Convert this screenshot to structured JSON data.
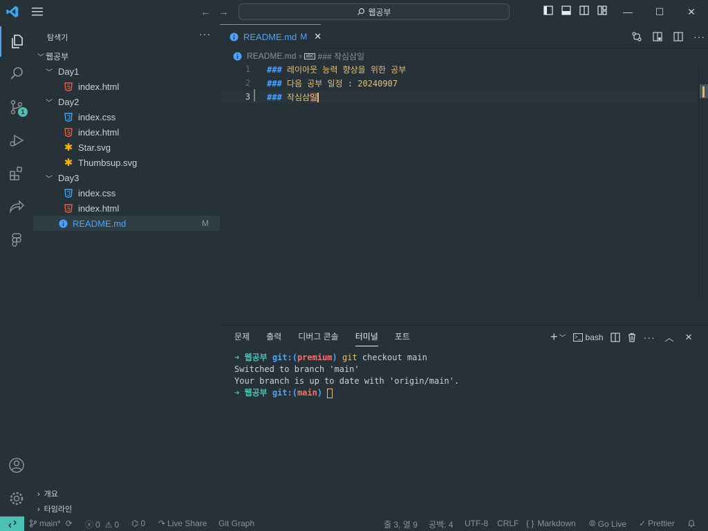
{
  "title_bar": {
    "search_text": "웹공부",
    "back": "←",
    "forward": "→"
  },
  "activity_bar": {
    "scm_badge": "1"
  },
  "sidebar": {
    "title": "탐색기",
    "more": "···",
    "root": "웹공부",
    "items": [
      {
        "type": "folder",
        "label": "Day1"
      },
      {
        "type": "html",
        "label": "index.html"
      },
      {
        "type": "folder",
        "label": "Day2"
      },
      {
        "type": "css",
        "label": "index.css"
      },
      {
        "type": "html",
        "label": "index.html"
      },
      {
        "type": "svg",
        "label": "Star.svg"
      },
      {
        "type": "svg",
        "label": "Thumbsup.svg"
      },
      {
        "type": "folder",
        "label": "Day3"
      },
      {
        "type": "css",
        "label": "index.css"
      },
      {
        "type": "html",
        "label": "index.html"
      },
      {
        "type": "md",
        "label": "README.md",
        "status": "M"
      }
    ],
    "outline": "개요",
    "timeline": "타임라인"
  },
  "editor": {
    "tab_label": "README.md",
    "tab_status": "M",
    "breadcrumb_file": "README.md",
    "breadcrumb_symbol": "### 작심삼일",
    "lines": [
      {
        "num": "1",
        "hash": "###",
        "text": " 레이아웃 능력 향상을 위한 공부"
      },
      {
        "num": "2",
        "hash": "###",
        "text": " 다음 공부 일정 : 20240907"
      },
      {
        "num": "3",
        "hash": "###",
        "text_pre": " 작심삼",
        "text_hl": "일"
      }
    ]
  },
  "panel": {
    "tabs": [
      "문제",
      "출력",
      "디버그 콘솔",
      "터미널",
      "포트"
    ],
    "active_tab": "터미널",
    "shell": "bash",
    "terminal": {
      "line1_arrow": "➜",
      "line1_dir": "웹공부",
      "line1_git": "git:(",
      "line1_branch": "premium",
      "line1_close": ")",
      "line1_cmd": "git",
      "line1_rest": " checkout main",
      "line2": "Switched to branch 'main'",
      "line3": "Your branch is up to date with 'origin/main'.",
      "line4_arrow": "➜",
      "line4_dir": "웹공부",
      "line4_git": "git:(",
      "line4_branch": "main",
      "line4_close": ")"
    }
  },
  "status_bar": {
    "branch": "main*",
    "errors": "0",
    "warnings": "0",
    "ports": "0",
    "live_share": "Live Share",
    "git_graph": "Git Graph",
    "position": "줄 3, 열 9",
    "spaces": "공백: 4",
    "encoding": "UTF-8",
    "eol": "CRLF",
    "language": "Markdown",
    "go_live": "Go Live",
    "prettier": "Prettier"
  }
}
